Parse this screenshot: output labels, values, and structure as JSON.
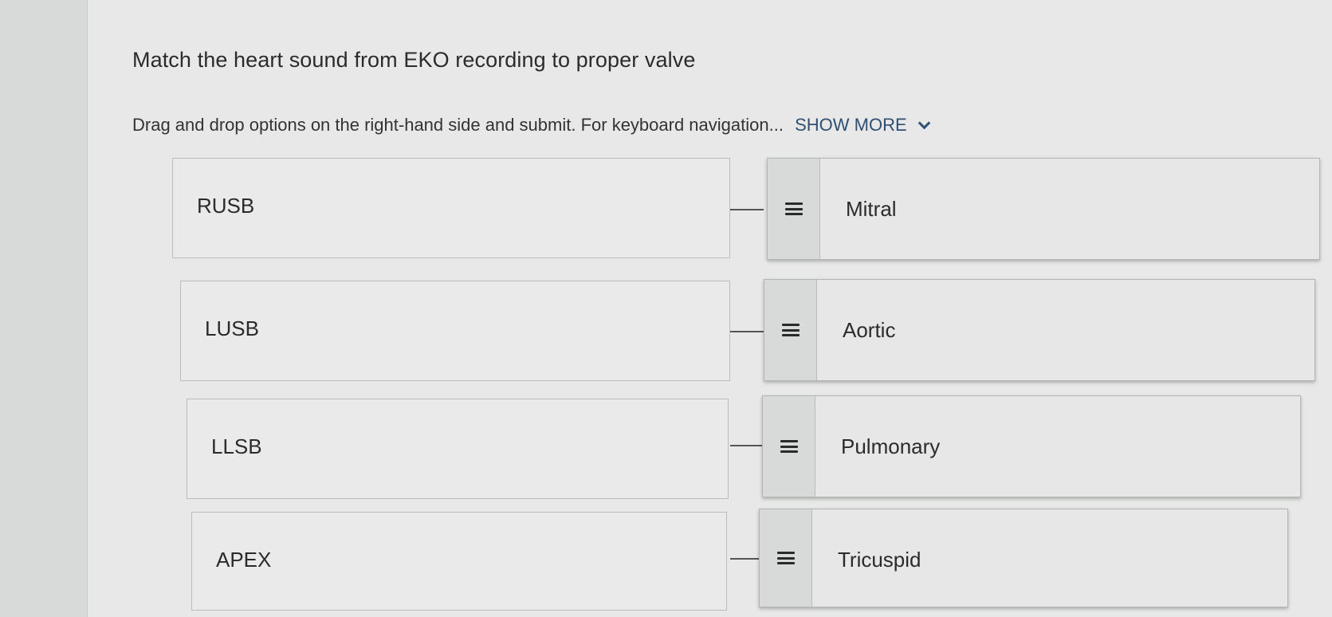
{
  "question": {
    "title": "Match the heart sound from EKO recording to proper valve",
    "instructions": "Drag and drop options on the right-hand side and submit. For keyboard navigation...",
    "show_more_label": "SHOW MORE"
  },
  "pairs": [
    {
      "prompt": "RUSB",
      "answer": "Mitral"
    },
    {
      "prompt": "LUSB",
      "answer": "Aortic"
    },
    {
      "prompt": "LLSB",
      "answer": "Pulmonary"
    },
    {
      "prompt": "APEX",
      "answer": "Tricuspid"
    }
  ],
  "icons": {
    "drag_handle": "drag-handle-icon",
    "show_more": "chevron-down-icon"
  },
  "colors": {
    "link": "#2f4f73",
    "page_background": "#e7e8e7"
  }
}
